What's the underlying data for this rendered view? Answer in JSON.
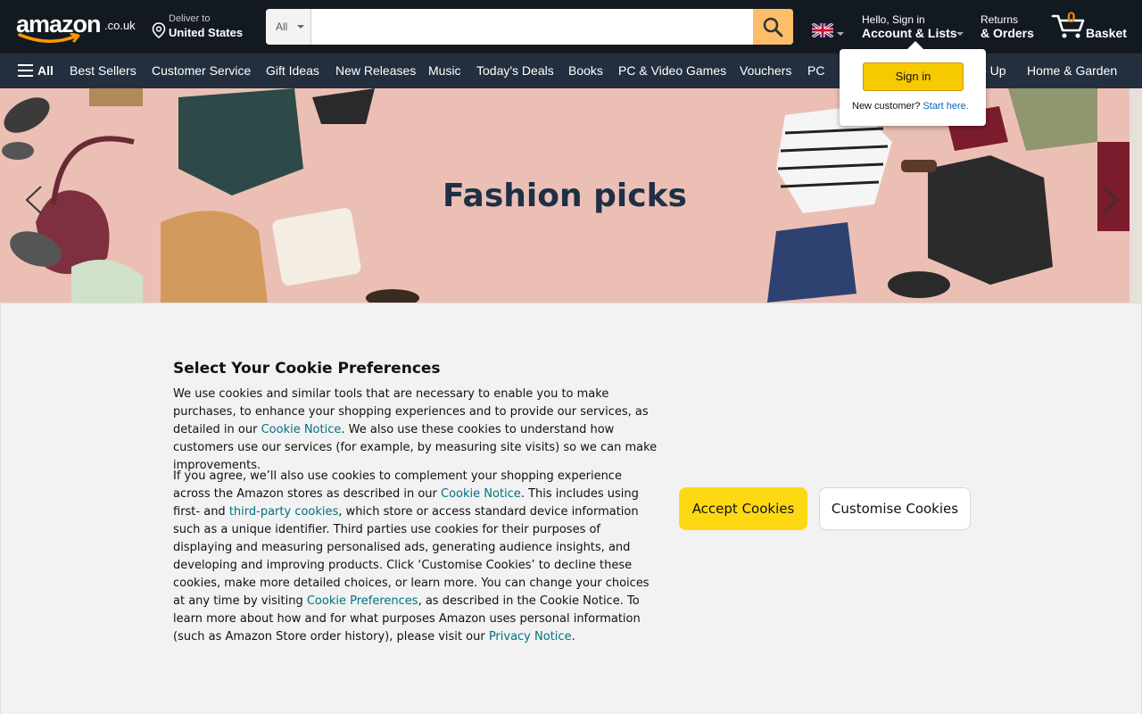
{
  "header": {
    "logo_word": "amazon",
    "logo_tld": ".co.uk",
    "deliver_line1": "Deliver to",
    "deliver_line2": "United States",
    "search_category": "All",
    "search_placeholder": "",
    "account_line1": "Hello, Sign in",
    "account_line2": "Account & Lists",
    "returns_line1": "Returns",
    "returns_line2": "& Orders",
    "basket_count": "0",
    "basket_label": "Basket"
  },
  "nav": {
    "all_label": "All",
    "items": [
      "Best Sellers",
      "Customer Service",
      "Gift Ideas",
      "New Releases",
      "Music",
      "Today's Deals",
      "Books",
      "PC & Video Games",
      "Vouchers",
      "PC",
      "o Up",
      "Home & Garden"
    ]
  },
  "hero": {
    "title": "Fashion picks"
  },
  "flyout": {
    "signin_label": "Sign in",
    "new_customer": "New customer?",
    "start_here": "Start here."
  },
  "cookie": {
    "title": "Select Your Cookie Preferences",
    "p1_a": "We use cookies and similar tools that are necessary to enable you to make purchases, to enhance your shopping experiences and to provide our services, as detailed in our ",
    "p1_link": "Cookie Notice",
    "p1_b": ". We also use these cookies to understand how customers use our services (for example, by measuring site visits) so we can make improvements.",
    "p2_a": "If you agree, we’ll also use cookies to complement your shopping experience across the Amazon stores as described in our ",
    "p2_link1": "Cookie Notice",
    "p2_b": ". This includes using first- and ",
    "p2_link2": "third-party cookies",
    "p2_c": ", which store or access standard device information such as a unique identifier. Third parties use cookies for their purposes of displaying and measuring personalised ads, generating audience insights, and developing and improving products. Click ‘Customise Cookies’ to decline these cookies, make more detailed choices, or learn more. You can change your choices at any time by visiting ",
    "p2_link3": "Cookie Preferences",
    "p2_d": ", as described in the Cookie Notice. To learn more about how and for what purposes Amazon uses personal information (such as Amazon Store order history), please visit our ",
    "p2_link4": "Privacy Notice",
    "p2_e": ".",
    "accept_label": "Accept Cookies",
    "customise_label": "Customise Cookies"
  },
  "colors": {
    "header_bg": "#131921",
    "subnav_bg": "#232f3e",
    "search_button": "#febd69",
    "accept_button": "#ffd814",
    "link": "#007185"
  }
}
